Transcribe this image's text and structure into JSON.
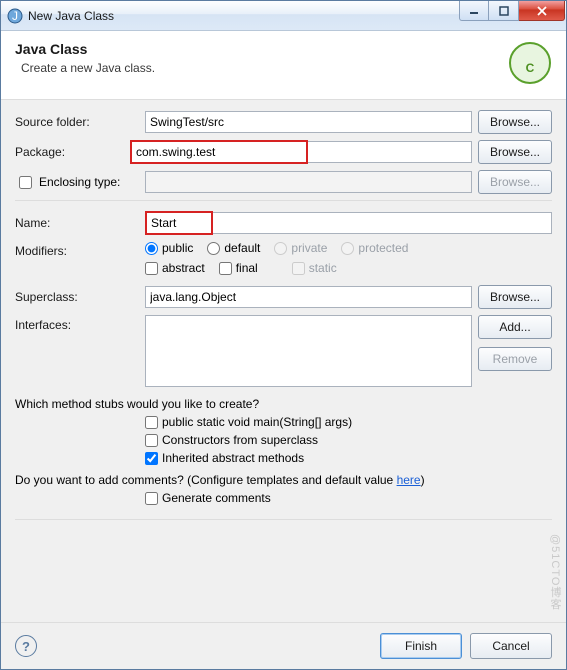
{
  "title": "New Java Class",
  "header": {
    "title": "Java Class",
    "subtitle": "Create a new Java class."
  },
  "labels": {
    "sourceFolder": "Source folder:",
    "package": "Package:",
    "enclosingType": "Enclosing type:",
    "name": "Name:",
    "modifiers": "Modifiers:",
    "superclass": "Superclass:",
    "interfaces": "Interfaces:"
  },
  "fields": {
    "sourceFolder": "SwingTest/src",
    "package": "com.swing.test",
    "enclosingType": "",
    "name": "Start",
    "superclass": "java.lang.Object"
  },
  "buttons": {
    "browse": "Browse...",
    "add": "Add...",
    "remove": "Remove",
    "finish": "Finish",
    "cancel": "Cancel"
  },
  "modifiers": {
    "public": "public",
    "default": "default",
    "private": "private",
    "protected": "protected",
    "abstract": "abstract",
    "final": "final",
    "static": "static"
  },
  "stubs": {
    "question": "Which method stubs would you like to create?",
    "main": "public static void main(String[] args)",
    "constructors": "Constructors from superclass",
    "inherited": "Inherited abstract methods"
  },
  "comments": {
    "question_pre": "Do you want to add comments? (Configure templates and default value ",
    "link": "here",
    "question_post": ")",
    "generate": "Generate comments"
  },
  "watermark": "@51CTO博客"
}
